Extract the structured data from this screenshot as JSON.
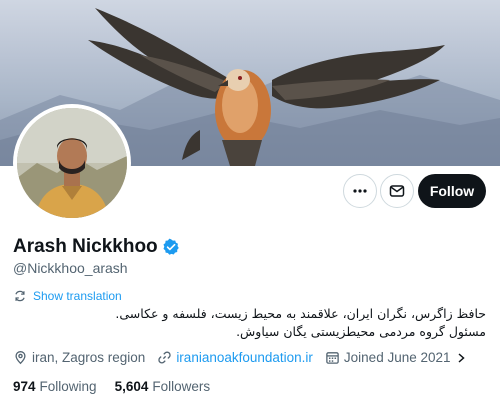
{
  "profile": {
    "display_name": "Arash Nickkhoo",
    "handle": "@Nickkhoo_arash",
    "verified": true,
    "show_translation": "Show translation",
    "bio_line1": "حافظ زاگرس، نگران ایران، علاقمند به محیط زیست، فلسفه و عکاسی.",
    "bio_line2": "مسئول گروه مردمی محیطزیستی یگان سیاوش.",
    "location": "iran, Zagros region",
    "website": "iranianoakfoundation.ir",
    "joined": "Joined June 2021",
    "following_count": "974",
    "following_label": "Following",
    "followers_count": "5,604",
    "followers_label": "Followers"
  },
  "actions": {
    "more": "more-icon",
    "message": "mail-icon",
    "follow_label": "Follow"
  },
  "colors": {
    "accent": "#1d9bf0",
    "text": "#0f1419",
    "muted": "#536471",
    "follow_bg": "#0f1419"
  }
}
